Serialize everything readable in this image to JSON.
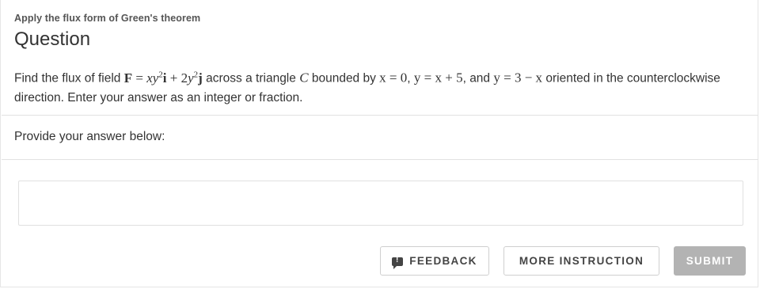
{
  "header": {
    "breadcrumb": "Apply the flux form of Green's theorem",
    "title": "Question"
  },
  "question": {
    "t1": "Find the flux of field ",
    "F": "F",
    "eq": " = ",
    "xy": "xy",
    "sq1": "2",
    "i": "i",
    "plus": " + 2",
    "y": "y",
    "sq2": "2",
    "j": "j",
    "t2": " across a triangle ",
    "C": "C",
    "t3": " bounded by ",
    "b1": "x = 0",
    "c1": ", ",
    "b2": "y = x + 5",
    "c2": ", and ",
    "b3": "y = 3 − x",
    "t4": " oriented in the counterclockwise direction. Enter your answer as an integer or fraction."
  },
  "answer": {
    "label": "Provide your answer below:",
    "value": "",
    "placeholder": ""
  },
  "actions": {
    "feedback_icon": "feedback-icon",
    "feedback": "FEEDBACK",
    "more": "MORE INSTRUCTION",
    "submit": "SUBMIT"
  },
  "colors": {
    "submit_bg": "#b3b3b3",
    "text": "#333333",
    "border": "#e2e2e2"
  }
}
